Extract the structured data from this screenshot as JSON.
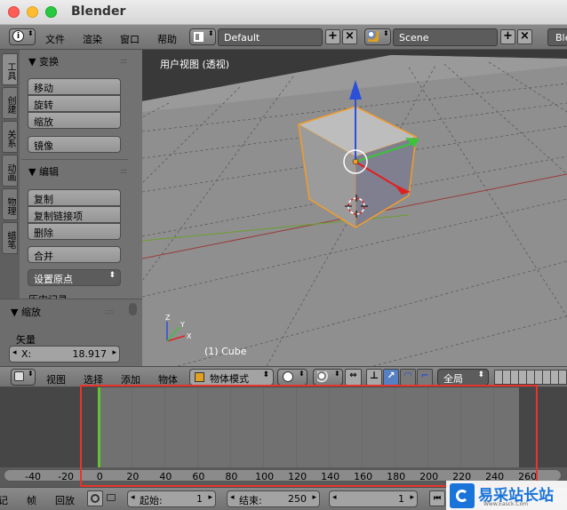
{
  "window": {
    "title": "Blender"
  },
  "top_menu": {
    "file": "文件",
    "render": "渲染",
    "window": "窗口",
    "help": "帮助"
  },
  "screen_layout": {
    "value": "Default"
  },
  "scene": {
    "value": "Scene"
  },
  "render_engine": {
    "value": "Ble"
  },
  "left_tabs": [
    "工具",
    "创建",
    "关系",
    "动画",
    "物理",
    "蜡笔"
  ],
  "transform_panel": {
    "title": "▼ 变换",
    "move": "移动",
    "rotate": "旋转",
    "scale": "缩放",
    "mirror": "镜像"
  },
  "edit_panel": {
    "title": "▼ 编辑",
    "duplicate": "复制",
    "duplicate_linked": "复制链接项",
    "delete": "删除",
    "join": "合并",
    "set_origin": "设置原点",
    "history": "历史记录"
  },
  "operator_panel": {
    "title": "▼ 缩放",
    "vector_label": "矢量",
    "x_label": "X:",
    "x_value": "18.917"
  },
  "viewport": {
    "view_label": "用户视图 (透视)",
    "object_label": "(1) Cube",
    "axis_x": "X",
    "axis_y": "Y",
    "axis_z": "Z"
  },
  "viewport_header": {
    "view": "视图",
    "select": "选择",
    "add": "添加",
    "object": "物体",
    "mode": "物体模式",
    "orientation": "全局"
  },
  "timeline": {
    "current_frame": 1,
    "ticks": [
      "-40",
      "-20",
      "0",
      "20",
      "40",
      "60",
      "80",
      "100",
      "120",
      "140",
      "160",
      "180",
      "200",
      "220",
      "240",
      "260"
    ],
    "start_label": "起始:",
    "start_value": "1",
    "end_label": "结束:",
    "end_value": "250",
    "frame_value": "1"
  },
  "timeline_footer": {
    "marker": "记",
    "frame": "帧",
    "playback": "回放"
  },
  "watermark": {
    "text": "易采站长站",
    "sub": "Www.Easck.Com"
  },
  "colors": {
    "highlight": "#e8342b",
    "selection": "#f39c2c",
    "frame_marker": "#5fc332"
  }
}
